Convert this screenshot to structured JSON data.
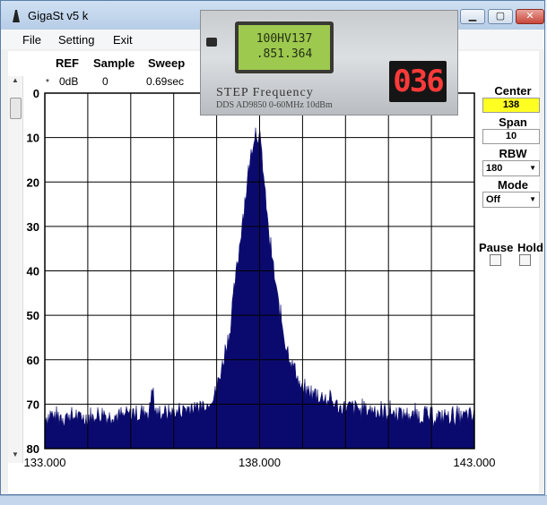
{
  "window": {
    "title": "GigaSt v5 k"
  },
  "menu": {
    "file": "File",
    "setting": "Setting",
    "exit": "Exit"
  },
  "header": {
    "ref_label": "REF",
    "sample_label": "Sample",
    "sweep_label": "Sweep",
    "ref_marker": "*",
    "ref_value": "0dB",
    "sample_value": "0",
    "sweep_value": "0.69sec"
  },
  "side": {
    "center_label": "Center",
    "center_value": "138",
    "span_label": "Span",
    "span_value": "10",
    "rbw_label": "RBW",
    "rbw_value": "180",
    "mode_label": "Mode",
    "mode_value": "Off",
    "pause_label": "Pause",
    "hold_label": "Hold"
  },
  "photo": {
    "lcd_line1": "100HV137",
    "lcd_line2": ".851.364",
    "led_digits": "036",
    "label1": "STEP Frequency",
    "label2": "DDS AD9850 0-60MHz 10dBm"
  },
  "colors": {
    "trace": "#0a0a6e",
    "center_highlight": "#ffff22",
    "led": "#ff3a3a",
    "lcd": "#9ec94f"
  },
  "chart_data": {
    "type": "area",
    "x_tick_labels": [
      "133.000",
      "138.000",
      "143.000"
    ],
    "y_tick_labels": [
      "0",
      "10",
      "20",
      "30",
      "40",
      "50",
      "60",
      "70",
      "80"
    ],
    "xlim": [
      133,
      143
    ],
    "ylim": [
      0,
      80
    ],
    "y_inverted": true,
    "grid": true,
    "x": [
      133,
      134,
      135,
      135.45,
      135.5,
      135.55,
      136,
      136.5,
      136.8,
      137.0,
      137.3,
      137.5,
      137.7,
      137.85,
      137.9,
      138.0,
      138.1,
      138.2,
      138.4,
      138.6,
      139.0,
      139.5,
      140,
      141,
      142,
      143
    ],
    "values": [
      74,
      74,
      73.5,
      73,
      66,
      73,
      73,
      72,
      71,
      68,
      55,
      38,
      22,
      12,
      10,
      11,
      20,
      32,
      46,
      58,
      68,
      70,
      72,
      73,
      74,
      74
    ]
  }
}
